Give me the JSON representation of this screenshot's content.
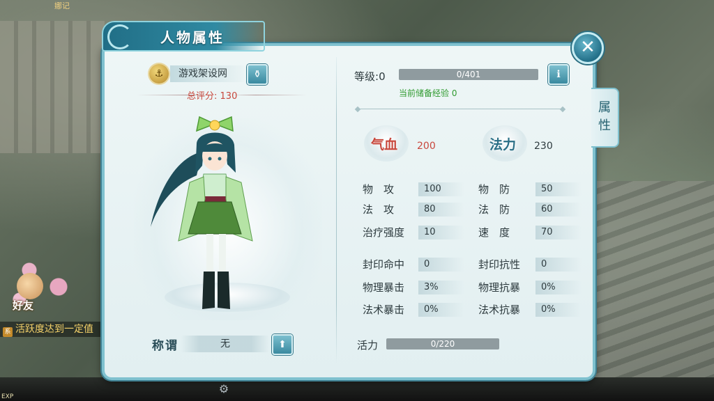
{
  "hud": {
    "top_label": "娜记",
    "friend_label": "好友",
    "chat_text": "活跃度达到一定值",
    "exp_label": "EXP"
  },
  "panel": {
    "title": "人物属性",
    "side_tab": "属性"
  },
  "character": {
    "name": "游戏架设网",
    "score_label": "总评分:",
    "score_value": "130",
    "title_label": "称谓",
    "title_value": "无"
  },
  "level": {
    "label": "等级:",
    "value": "0",
    "exp_bar_text": "0/401",
    "exp_progress": 0,
    "stored_exp_label": "当前储备经验",
    "stored_exp_value": "0"
  },
  "vitals": {
    "hp_label": "气血",
    "hp_value": "200",
    "mp_label": "法力",
    "mp_value": "230"
  },
  "stats_left": [
    {
      "label": "物　攻",
      "value": "100"
    },
    {
      "label": "法　攻",
      "value": "80"
    },
    {
      "label": "治疗强度",
      "value": "10"
    },
    {
      "label": "封印命中",
      "value": "0"
    },
    {
      "label": "物理暴击",
      "value": "3%"
    },
    {
      "label": "法术暴击",
      "value": "0%"
    }
  ],
  "stats_right": [
    {
      "label": "物　防",
      "value": "50"
    },
    {
      "label": "法　防",
      "value": "60"
    },
    {
      "label": "速　度",
      "value": "70"
    },
    {
      "label": "封印抗性",
      "value": "0"
    },
    {
      "label": "物理抗暴",
      "value": "0%"
    },
    {
      "label": "法术抗暴",
      "value": "0%"
    }
  ],
  "vitality": {
    "label": "活力",
    "bar_text": "0/220",
    "progress": 0
  },
  "colors": {
    "accent": "#2f8aa2",
    "hp_text": "#c8473c",
    "mp_text": "#2a6f86",
    "score_text": "#c8473c",
    "exp_note": "#2f9a2f"
  }
}
